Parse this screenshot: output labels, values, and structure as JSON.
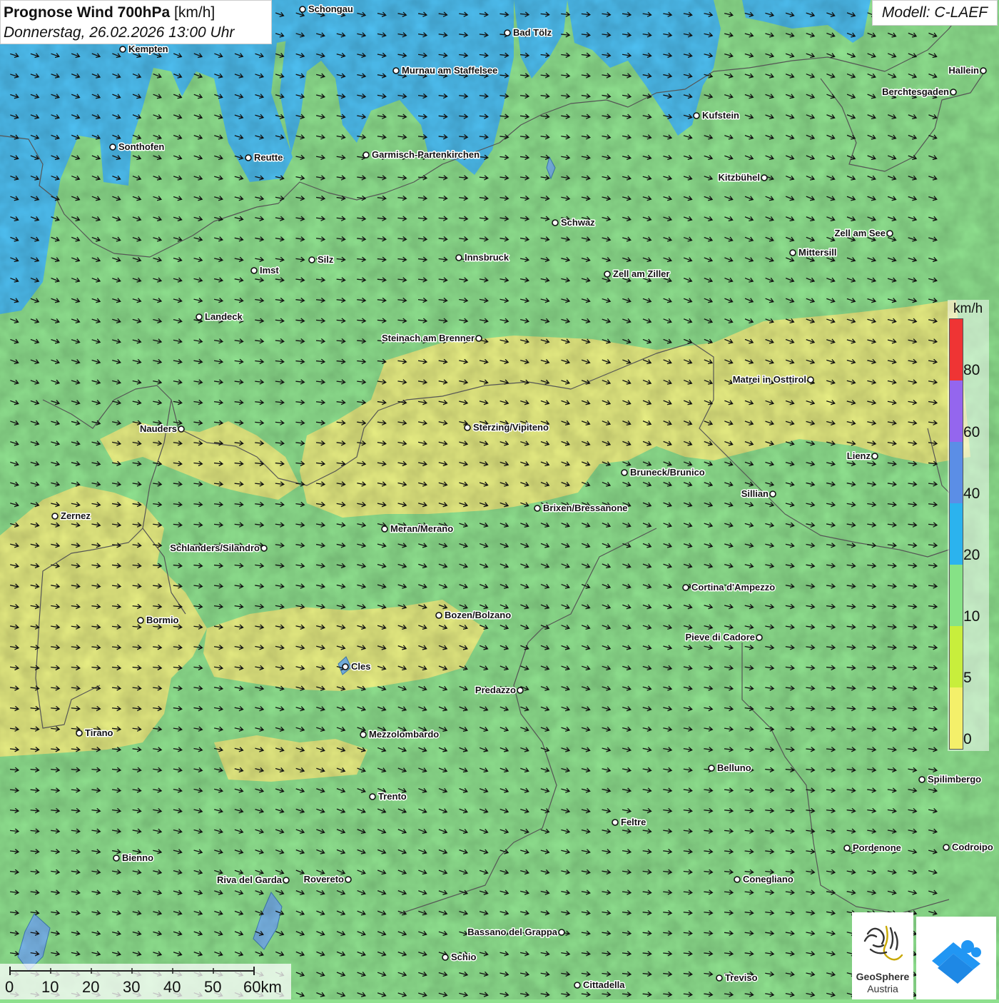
{
  "header": {
    "title_bold": "Prognose Wind 700hPa",
    "title_unit": "[km/h]",
    "subtitle": "Donnerstag, 26.02.2026 13:00 Uhr"
  },
  "model": {
    "label": "Modell: C-LAEF"
  },
  "legend": {
    "unit": "km/h",
    "ticks": [
      "80",
      "60",
      "40",
      "20",
      "10",
      "5",
      "0"
    ],
    "colors": [
      "#ef3434",
      "#9466ee",
      "#5b8ee6",
      "#2bb3ee",
      "#86e286",
      "#c8ee3c",
      "#f4f06a"
    ]
  },
  "scale_bar": {
    "labels": [
      "0",
      "10",
      "20",
      "30",
      "40",
      "50",
      "60km"
    ]
  },
  "logos": {
    "geosphere_line1": "GeoSphere",
    "geosphere_line2": "Austria"
  },
  "colors": {
    "calm_yellow": "#e6ec82",
    "light_green": "#8ee08e",
    "water_blue": "#4dbef0",
    "arrow": "#111111"
  },
  "cities": [
    {
      "name": "Schongau"
    },
    {
      "name": "Bad Tölz"
    },
    {
      "name": "Kempten"
    },
    {
      "name": "Murnau am Staffelsee"
    },
    {
      "name": "Hallein"
    },
    {
      "name": "Berchtesgaden"
    },
    {
      "name": "Kufstein"
    },
    {
      "name": "Sonthofen"
    },
    {
      "name": "Reutte"
    },
    {
      "name": "Garmisch-Partenkirchen"
    },
    {
      "name": "Kitzbühel"
    },
    {
      "name": "Schwaz"
    },
    {
      "name": "Zell am See"
    },
    {
      "name": "Innsbruck"
    },
    {
      "name": "Mittersill"
    },
    {
      "name": "Silz"
    },
    {
      "name": "Imst"
    },
    {
      "name": "Zell am Ziller"
    },
    {
      "name": "Landeck"
    },
    {
      "name": "Steinach am Brenner"
    },
    {
      "name": "Matrei in Osttirol"
    },
    {
      "name": "Nauders"
    },
    {
      "name": "Sterzing/Vipiteno"
    },
    {
      "name": "Lienz"
    },
    {
      "name": "Bruneck/Brunico"
    },
    {
      "name": "Sillian"
    },
    {
      "name": "Zernez"
    },
    {
      "name": "Brixen/Bressanone"
    },
    {
      "name": "Meran/Merano"
    },
    {
      "name": "Schlanders/Silandro"
    },
    {
      "name": "Cortina d'Ampezzo"
    },
    {
      "name": "Bozen/Bolzano"
    },
    {
      "name": "Bormio"
    },
    {
      "name": "Pieve di Cadore"
    },
    {
      "name": "Cles"
    },
    {
      "name": "Predazzo"
    },
    {
      "name": "Tirano"
    },
    {
      "name": "Mezzolombardo"
    },
    {
      "name": "Belluno"
    },
    {
      "name": "Spilimbergo"
    },
    {
      "name": "Trento"
    },
    {
      "name": "Feltre"
    },
    {
      "name": "Pordenone"
    },
    {
      "name": "Codroipo"
    },
    {
      "name": "Bienno"
    },
    {
      "name": "Riva del Garda"
    },
    {
      "name": "Rovereto"
    },
    {
      "name": "Conegliano"
    },
    {
      "name": "Bassano del Grappa"
    },
    {
      "name": "Schio"
    },
    {
      "name": "Treviso"
    },
    {
      "name": "Cittadella"
    }
  ]
}
